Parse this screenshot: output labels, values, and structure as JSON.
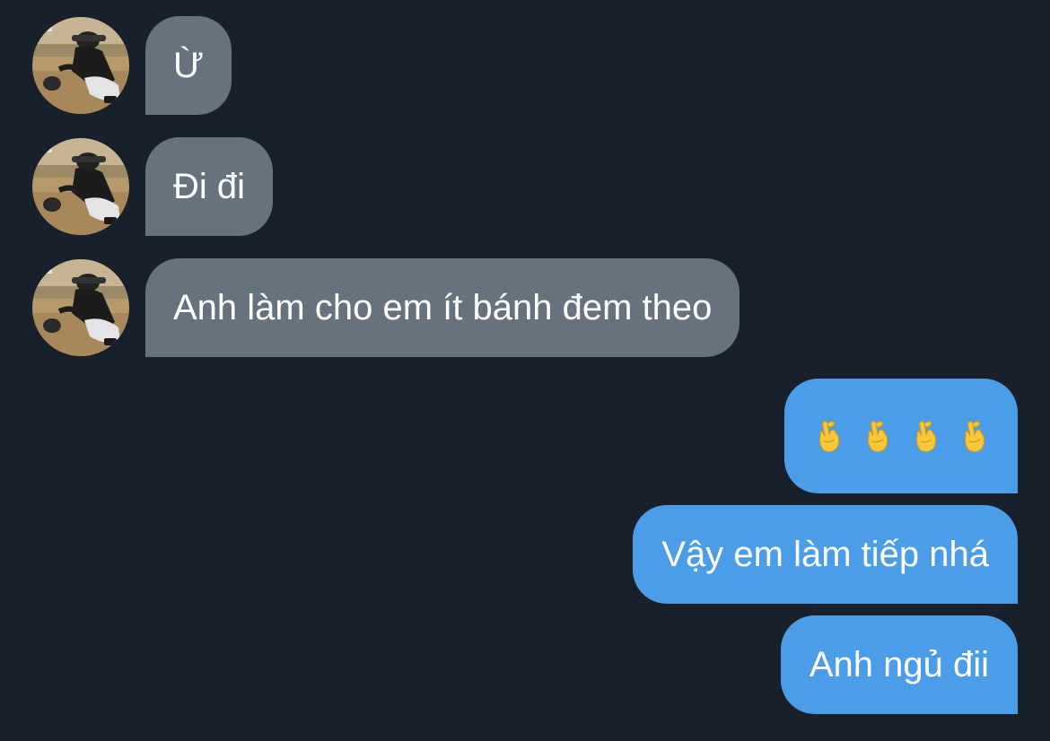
{
  "conversation": {
    "incoming": [
      {
        "text": "Ừ"
      },
      {
        "text": "Đi đi"
      },
      {
        "text": "Anh làm cho em ít bánh đem theo"
      }
    ],
    "outgoing": [
      {
        "emoji_count": 4,
        "icon": "finger-heart-emoji"
      },
      {
        "text": "Vậy em làm tiếp nhá"
      },
      {
        "text": "Anh ngủ đii"
      }
    ]
  },
  "colors": {
    "background": "#18202b",
    "incoming_bubble": "#66737f",
    "outgoing_bubble": "#4a9de6",
    "text": "#ffffff"
  }
}
